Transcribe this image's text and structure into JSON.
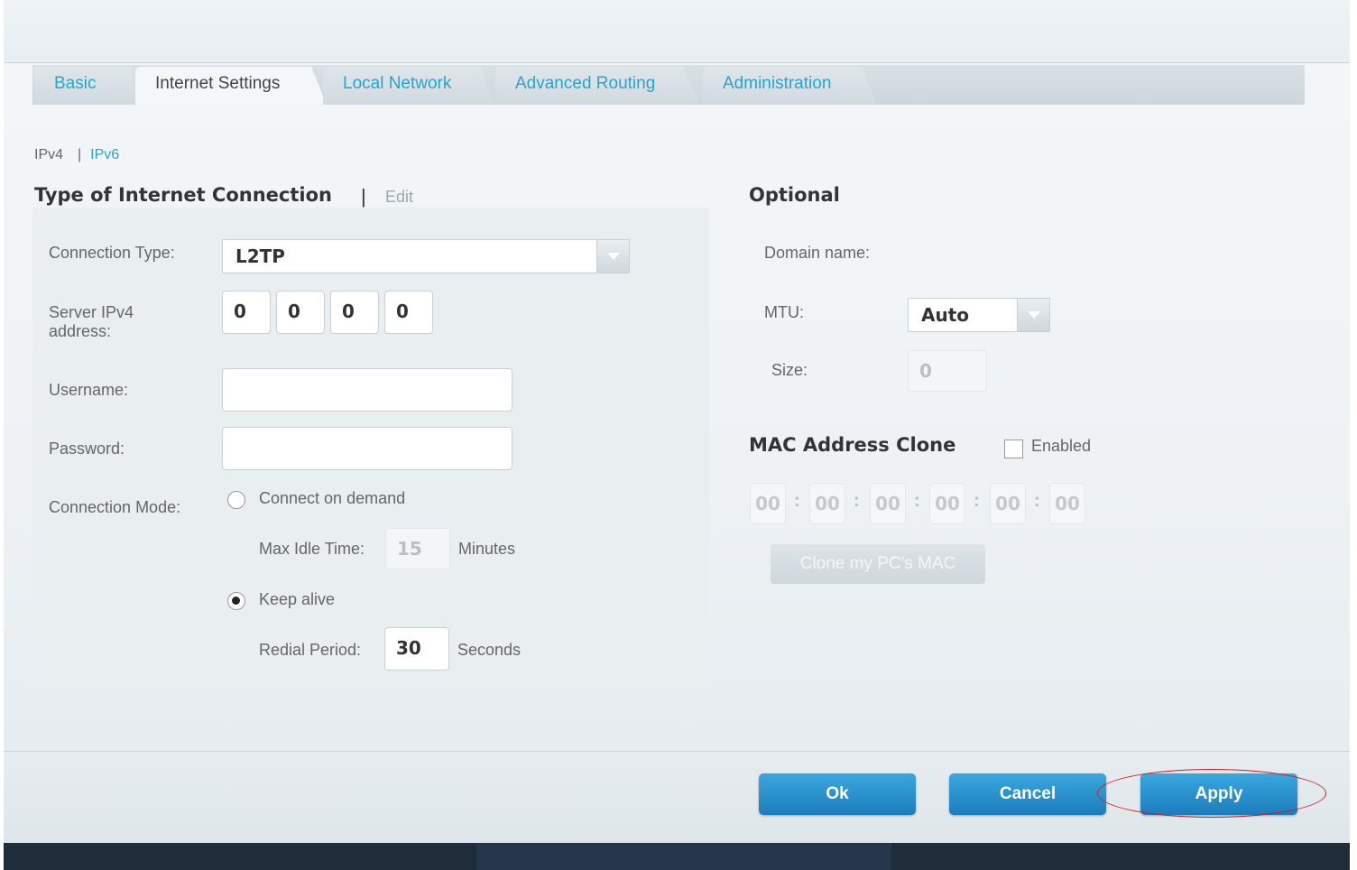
{
  "tabs": [
    {
      "label": "Basic",
      "active": false
    },
    {
      "label": "Internet Settings",
      "active": true
    },
    {
      "label": "Local Network",
      "active": false
    },
    {
      "label": "Advanced Routing",
      "active": false
    },
    {
      "label": "Administration",
      "active": false
    }
  ],
  "subnav": {
    "ipv4": "IPv4",
    "ipv6": "IPv6"
  },
  "connection": {
    "title": "Type of Internet Connection",
    "edit_label": "Edit",
    "type_label": "Connection Type:",
    "type_value": "L2TP",
    "server_label": "Server IPv4 address:",
    "server_octets": [
      "0",
      "0",
      "0",
      "0"
    ],
    "username_label": "Username:",
    "username_value": "",
    "password_label": "Password:",
    "password_value": "",
    "mode_label": "Connection Mode:",
    "connect_on_demand_label": "Connect on demand",
    "max_idle_label": "Max Idle Time:",
    "max_idle_value": "15",
    "minutes_label": "Minutes",
    "keep_alive_label": "Keep alive",
    "redial_label": "Redial Period:",
    "redial_value": "30",
    "seconds_label": "Seconds",
    "selected_mode": "Keep alive"
  },
  "optional": {
    "title": "Optional",
    "domain_label": "Domain name:",
    "mtu_label": "MTU:",
    "mtu_value": "Auto",
    "size_label": "Size:",
    "size_value": "0"
  },
  "mac_clone": {
    "title": "MAC Address Clone",
    "enabled_label": "Enabled",
    "enabled": false,
    "segments": [
      "00",
      "00",
      "00",
      "00",
      "00",
      "00"
    ],
    "clone_button": "Clone my PC's MAC"
  },
  "footer": {
    "ok_label": "Ok",
    "cancel_label": "Cancel",
    "apply_label": "Apply"
  },
  "colors": {
    "accent": "#2aa3c9",
    "button_blue": "#1c7dbc",
    "annotation_red": "#d21b1b"
  }
}
